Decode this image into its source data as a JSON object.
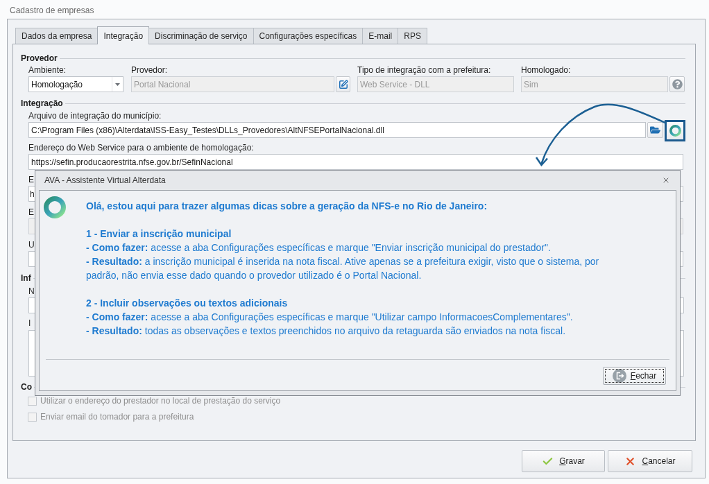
{
  "window": {
    "title": "Cadastro de empresas"
  },
  "tabs": [
    {
      "label": "Dados da empresa",
      "selected": false
    },
    {
      "label": "Integração",
      "selected": true
    },
    {
      "label": "Discriminação de serviço",
      "selected": false
    },
    {
      "label": "Configurações específicas",
      "selected": false
    },
    {
      "label": "E-mail",
      "selected": false
    },
    {
      "label": "RPS",
      "selected": false
    }
  ],
  "provedor": {
    "title": "Provedor",
    "ambiente": {
      "label": "Ambiente:",
      "value": "Homologação",
      "disabled": false
    },
    "provedor": {
      "label": "Provedor:",
      "value": "Portal Nacional",
      "disabled": true
    },
    "tipo_integracao": {
      "label": "Tipo de integração com a prefeitura:",
      "value": "Web Service - DLL",
      "disabled": true
    },
    "homologado": {
      "label": "Homologado:",
      "value": "Sim",
      "disabled": true
    }
  },
  "integracao": {
    "title": "Integração",
    "arquivo": {
      "label": "Arquivo de integração do município:",
      "value": "C:\\Program Files (x86)\\Alterdata\\ISS-Easy_Testes\\DLLs_Provedores\\AltNFSEPortalNacional.dll"
    },
    "endereco_homologacao": {
      "label": "Endereço do Web Service para o ambiente de homologação:",
      "value": "https://sefin.producaorestrita.nfse.gov.br/SefinNacional"
    },
    "fields": [
      {
        "label": "E",
        "value": "h",
        "disabled": false
      },
      {
        "label": "E",
        "disabled": true
      },
      {
        "label": "U",
        "disabled": false
      }
    ]
  },
  "group_3": {
    "title": "Inf",
    "fields": [
      {
        "label": "N",
        "kind": "combo"
      },
      {
        "label": "I",
        "kind": "memo"
      }
    ]
  },
  "group_4": {
    "title": "Co",
    "checkboxes": [
      {
        "label": "Utilizar o endereço do prestador no local de prestação do serviço",
        "checked": false,
        "disabled": true
      },
      {
        "label": "Enviar email do tomador para a prefeitura",
        "checked": false,
        "disabled": true
      }
    ]
  },
  "buttons": [
    {
      "label": "Gravar",
      "kind": "save"
    },
    {
      "label": "Cancelar",
      "kind": "cancel"
    }
  ],
  "dialog": {
    "title": "AVA - Assistente Virtual Alterdata",
    "heading": "Olá, estou aqui para trazer algumas dicas sobre a geração da NFS-e no Rio de Janeiro:",
    "sections": [
      {
        "title": "1 - Enviar a inscrição municipal",
        "items": [
          "**- Como fazer:** acesse a aba Configurações específicas e marque \"Enviar inscrição municipal do prestador\".",
          "**- Resultado:** a inscrição municipal é inserida na nota fiscal. Ative apenas se a prefeitura exigir, visto que o sistema, por padrão, não envia esse dado quando o provedor utilizado é o Portal Nacional."
        ]
      },
      {
        "title": "2 - Incluir observações ou textos adicionais",
        "items": [
          "**- Como fazer:** acesse a aba Configurações específicas e marque \"Utilizar campo InformacoesComplementares\".",
          "**- Resultado:** todas as observações e textos preenchidos no arquivo da retaguarda são enviados na nota fiscal."
        ]
      }
    ],
    "button": {
      "label": "Fechar",
      "focused": true
    }
  }
}
